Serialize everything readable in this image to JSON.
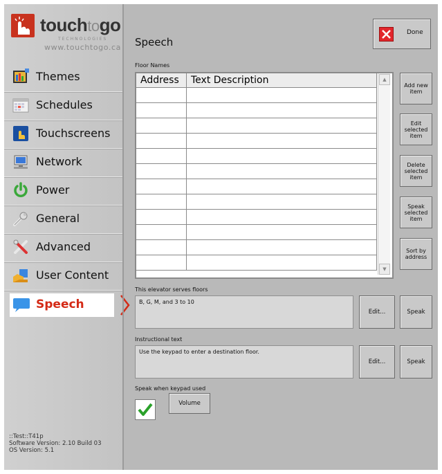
{
  "logo": {
    "brand": "touch",
    "brand_to": "to",
    "brand_go": "go",
    "tagline": "TECHNOLOGIES",
    "url": "www.touchtogo.ca"
  },
  "sidebar": {
    "items": [
      {
        "label": "Themes",
        "icon": "themes-icon"
      },
      {
        "label": "Schedules",
        "icon": "schedules-icon"
      },
      {
        "label": "Touchscreens",
        "icon": "touchscreens-icon"
      },
      {
        "label": "Network",
        "icon": "network-icon"
      },
      {
        "label": "Power",
        "icon": "power-icon"
      },
      {
        "label": "General",
        "icon": "general-icon"
      },
      {
        "label": "Advanced",
        "icon": "advanced-icon"
      },
      {
        "label": "User Content",
        "icon": "user-content-icon"
      },
      {
        "label": "Speech",
        "icon": "speech-icon",
        "active": true
      }
    ],
    "version": {
      "line1": "::Test::T41p",
      "line2": "Software Version: 2.10 Build 03",
      "line3": "OS Version: 5.1"
    }
  },
  "header": {
    "title": "Speech",
    "done_label": "Done"
  },
  "floor_names": {
    "label": "Floor Names",
    "columns": [
      "Address",
      "Text Description"
    ],
    "rows": 12
  },
  "side_buttons": {
    "add": "Add new item",
    "edit": "Edit selected item",
    "delete": "Delete selected item",
    "speak": "Speak selected item",
    "sort": "Sort by address"
  },
  "floors_served": {
    "label": "This elevator serves floors",
    "value": "B, G, M, and 3 to 10",
    "edit_label": "Edit...",
    "speak_label": "Speak"
  },
  "instructional": {
    "label": "Instructional text",
    "value": "Use the keypad to enter a destination floor.",
    "edit_label": "Edit...",
    "speak_label": "Speak"
  },
  "keypad": {
    "label": "Speak when keypad used",
    "checked": true,
    "volume_label": "Volume"
  },
  "colors": {
    "accent": "#d42a16",
    "background": "#b9b9b9",
    "check": "#2aa12a"
  }
}
